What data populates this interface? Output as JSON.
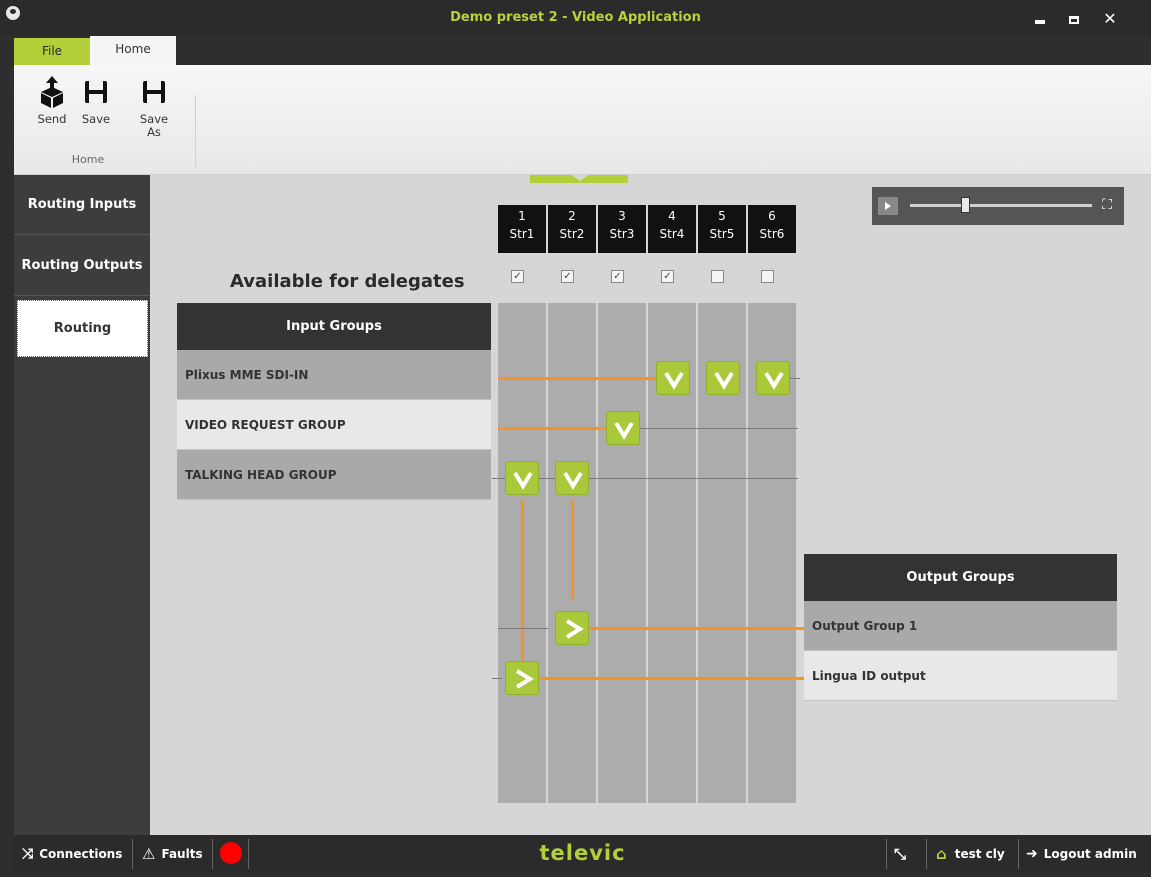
{
  "window": {
    "title": "Demo preset 2 - Video Application"
  },
  "ribbon": {
    "tabs": [
      "File",
      "Home"
    ],
    "buttons": {
      "send": "Send",
      "save": "Save",
      "save_as_1": "Save",
      "save_as_2": "As"
    },
    "group_label": "Home"
  },
  "sidebar": {
    "items": [
      "Routing Inputs",
      "Routing Outputs",
      "Routing"
    ]
  },
  "routing": {
    "available_label": "Available for delegates",
    "streams": [
      {
        "num": "1",
        "name": "Str1",
        "available": true
      },
      {
        "num": "2",
        "name": "Str2",
        "available": true
      },
      {
        "num": "3",
        "name": "Str3",
        "available": true
      },
      {
        "num": "4",
        "name": "Str4",
        "available": true
      },
      {
        "num": "5",
        "name": "Str5",
        "available": false
      },
      {
        "num": "6",
        "name": "Str6",
        "available": false
      }
    ],
    "input_groups": {
      "header": "Input Groups",
      "rows": [
        "Plixus MME SDI-IN",
        "VIDEO REQUEST GROUP",
        "TALKING HEAD GROUP"
      ]
    },
    "output_groups": {
      "header": "Output Groups",
      "rows": [
        "Output Group 1",
        "Lingua ID output"
      ]
    }
  },
  "player": {
    "position": 0.3
  },
  "statusbar": {
    "connections": "Connections",
    "faults": "Faults",
    "brand": "televic",
    "user": "test cly",
    "logout": "Logout admin"
  },
  "colors": {
    "accent": "#b3cf3a",
    "route_line": "#f7931e",
    "node": "#a9c93a"
  }
}
